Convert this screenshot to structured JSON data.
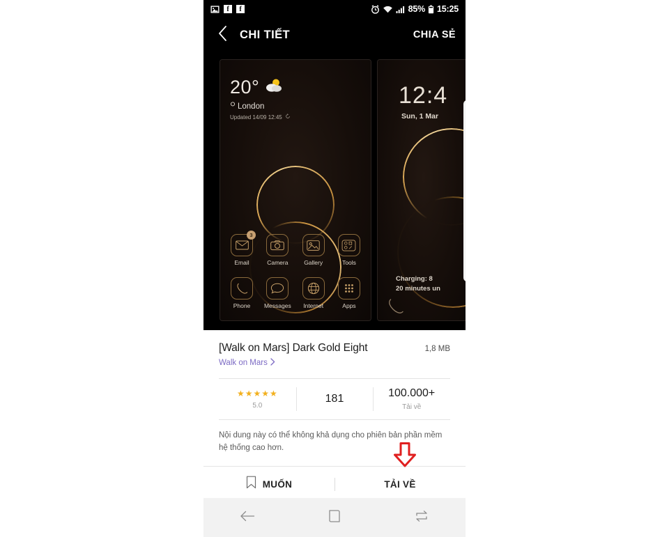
{
  "status_bar": {
    "left_icons": [
      "image-icon",
      "facebook-icon",
      "facebook-icon"
    ],
    "alarm_icon": "alarm-icon",
    "wifi_icon": "wifi-icon",
    "signal_icon": "signal-bars-icon",
    "battery_percent": "85%",
    "battery_icon": "battery-icon",
    "clock": "15:25"
  },
  "app_bar": {
    "back_icon": "chevron-left-icon",
    "title": "CHI TIẾT",
    "share_label": "CHIA SẺ"
  },
  "preview": {
    "home_card": {
      "weather": {
        "temperature": "20°",
        "weather_icon": "partly-cloudy-icon",
        "location_icon": "location-pin-icon",
        "city": "London",
        "updated": "Updated 14/09 12:45",
        "refresh_icon": "refresh-icon"
      },
      "apps_row1": [
        {
          "label": "Email",
          "icon": "email-icon",
          "badge": "3"
        },
        {
          "label": "Camera",
          "icon": "camera-icon",
          "badge": ""
        },
        {
          "label": "Gallery",
          "icon": "gallery-icon",
          "badge": ""
        },
        {
          "label": "Tools",
          "icon": "tools-folder-icon",
          "badge": ""
        }
      ],
      "apps_row2": [
        {
          "label": "Phone",
          "icon": "phone-icon",
          "badge": ""
        },
        {
          "label": "Messages",
          "icon": "messages-icon",
          "badge": ""
        },
        {
          "label": "Internet",
          "icon": "internet-globe-icon",
          "badge": ""
        },
        {
          "label": "Apps",
          "icon": "apps-grid-icon",
          "badge": ""
        }
      ]
    },
    "lock_card": {
      "time": "12:4",
      "date": "Sun, 1 Mar",
      "charging": "Charging: 8",
      "charging_sub": "20 minutes un",
      "phone_icon": "phone-icon"
    }
  },
  "details": {
    "title": "[Walk on Mars] Dark Gold Eight",
    "size": "1,8 MB",
    "developer": "Walk on Mars",
    "developer_chevron_icon": "chevron-right-icon",
    "stats": {
      "stars": "★★★★★",
      "rating": "5.0",
      "review_count": "181",
      "downloads": "100.000+",
      "downloads_label": "Tải về"
    },
    "notice": "Nội dung này có thể không khả dụng cho phiên bản phần mềm hệ thống cao hơn."
  },
  "action_bar": {
    "want_icon": "bookmark-icon",
    "want_label": "MUỐN",
    "download_label": "TẢI VỀ",
    "annotation_arrow_icon": "red-down-arrow-icon"
  },
  "nav_bar": {
    "back_icon": "nav-back-icon",
    "home_icon": "nav-home-icon",
    "recents_icon": "nav-recents-icon"
  },
  "colors": {
    "accent_gold": "#d9a552",
    "link_purple": "#7d6bc4",
    "star_gold": "#f2b01e",
    "annotation_red": "#e02020",
    "bar_black": "#000000"
  }
}
